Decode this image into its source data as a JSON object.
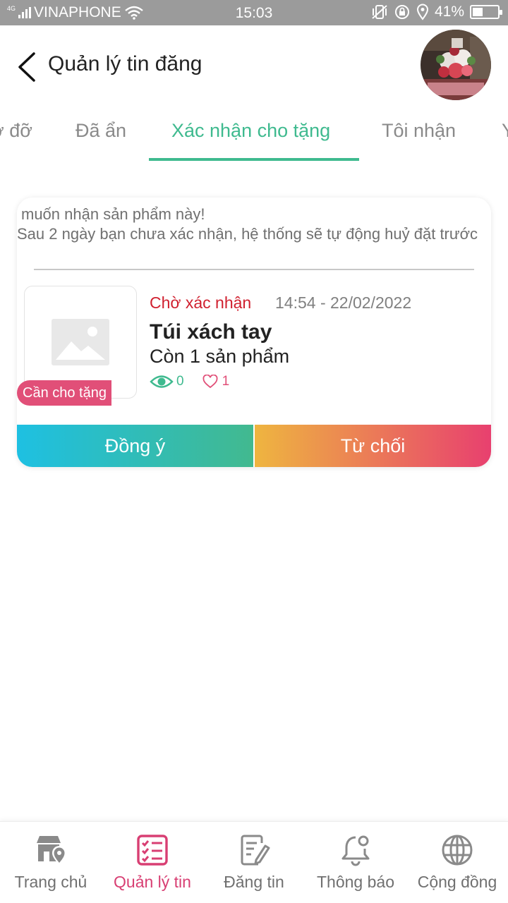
{
  "status_bar": {
    "network_type": "4G",
    "carrier": "VINAPHONE",
    "time": "15:03",
    "battery": "41%",
    "battery_level": 0.41
  },
  "header": {
    "title": "Quản lý tin đăng"
  },
  "tabs": [
    {
      "label": "ờ đỡ"
    },
    {
      "label": "Đã ẩn"
    },
    {
      "label": "Xác nhận cho tặng",
      "active": true
    },
    {
      "label": "Tôi nhận"
    },
    {
      "label": "Y"
    }
  ],
  "card": {
    "message_line1": "muốn nhận sản phẩm này!",
    "message_line2": "Sau 2 ngày bạn chưa xác nhận, hệ thống sẽ tự động huỷ đặt trước",
    "badge": "Cần cho tặng",
    "status": "Chờ xác nhận",
    "datetime": "14:54 - 22/02/2022",
    "product_name": "Túi xách tay",
    "stock": "Còn 1 sản phẩm",
    "views": "0",
    "likes": "1",
    "accept_label": "Đồng ý",
    "reject_label": "Từ chối"
  },
  "bottom_nav": [
    {
      "label": "Trang chủ",
      "icon": "store-location-icon"
    },
    {
      "label": "Quản lý tin",
      "icon": "checklist-icon",
      "active": true
    },
    {
      "label": "Đăng tin",
      "icon": "edit-document-icon"
    },
    {
      "label": "Thông báo",
      "icon": "bell-icon"
    },
    {
      "label": "Cộng đồng",
      "icon": "globe-icon"
    }
  ],
  "colors": {
    "accent_green": "#3fba8f",
    "accent_pink": "#e14f78",
    "status_red": "#d0202f",
    "status_bar_bg": "#9b9b9b"
  }
}
